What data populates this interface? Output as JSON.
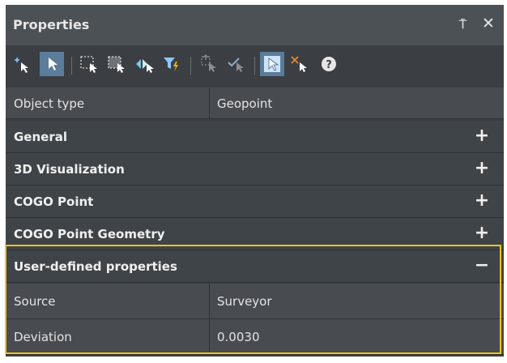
{
  "panel": {
    "title": "Properties",
    "pin_glyph": "⍑",
    "close_glyph": "✕"
  },
  "toolbar": {
    "icons": [
      "add-selection-icon",
      "select-icon",
      "window-select-icon",
      "crossing-select-icon",
      "select-similar-icon",
      "quick-filter-icon",
      "select-by-type-icon",
      "toggle-select-icon",
      "pickfirst-icon",
      "deselect-icon",
      "help-icon"
    ]
  },
  "object_type": {
    "label": "Object type",
    "value": "Geopoint"
  },
  "categories": [
    {
      "label": "General",
      "toggle": "+"
    },
    {
      "label": "3D Visualization",
      "toggle": "+"
    },
    {
      "label": "COGO Point",
      "toggle": "+"
    },
    {
      "label": "COGO Point Geometry",
      "toggle": "+"
    },
    {
      "label": "User-defined properties",
      "toggle": "−"
    }
  ],
  "user_defined": [
    {
      "label": "Source",
      "value": "Surveyor"
    },
    {
      "label": "Deviation",
      "value": "0.0030"
    }
  ],
  "colors": {
    "highlight": "#f0c419",
    "active_tool": "#5b7c9a",
    "filter_yellow": "#f5b400",
    "accent_blue": "#8fc6ff"
  }
}
